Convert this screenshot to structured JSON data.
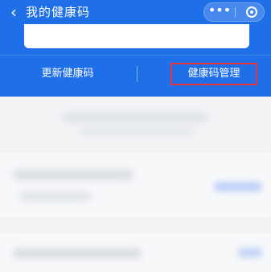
{
  "header": {
    "title": "我的健康码",
    "back_icon": "chevron-left-icon",
    "more_icon": "more-dots-icon",
    "close_icon": "circle-target-icon"
  },
  "actions": {
    "update_label": "更新健康码",
    "manage_label": "健康码管理"
  },
  "colors": {
    "primary": "#1f6fe8",
    "highlight_border": "#e8333b"
  }
}
